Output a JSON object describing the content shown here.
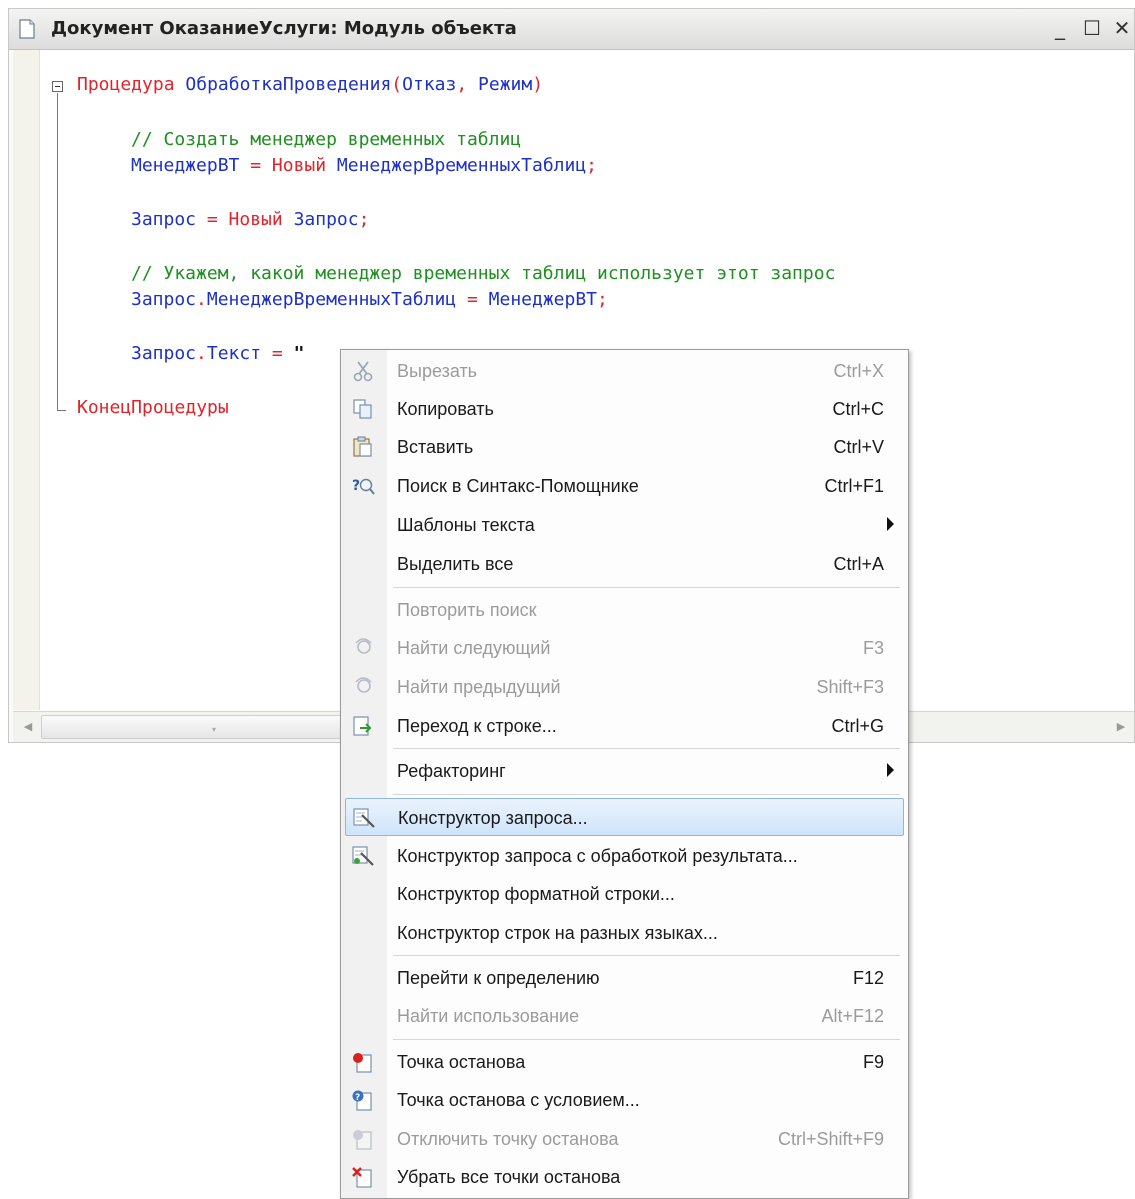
{
  "window": {
    "title": "Документ ОказаниеУслуги: Модуль объекта",
    "min_label": "_",
    "max_label": "☐",
    "close_label": "✕"
  },
  "code": {
    "line1": {
      "kw": "Процедура",
      "name": "ОбработкаПроведения",
      "paren_open": "(",
      "arg1": "Отказ",
      "comma": ", ",
      "arg2": "Режим",
      "paren_close": ")"
    },
    "line2": {
      "comment": "// Создать менеджер временных таблиц"
    },
    "line3": {
      "var": "МенеджерВТ",
      "eq": " = ",
      "new": "Новый",
      "type": " МенеджерВременныхТаблиц",
      "semi": ";"
    },
    "line4": {
      "var": "Запрос",
      "eq": " = ",
      "new": "Новый",
      "type": " Запрос",
      "semi": ";"
    },
    "line5": {
      "comment": "// Укажем, какой менеджер временных таблиц использует этот запрос"
    },
    "line6": {
      "obj": "Запрос",
      "dot": ".",
      "prop": "МенеджерВременныхТаблиц",
      "eq": " = ",
      "val": "МенеджерВТ",
      "semi": ";"
    },
    "line7": {
      "obj": "Запрос",
      "dot": ".",
      "prop": "Текст",
      "eq": " = ",
      "str": "\""
    },
    "line8": {
      "kw": "КонецПроцедуры"
    }
  },
  "context_menu": {
    "items": [
      {
        "label": "Вырезать",
        "shortcut": "Ctrl+X",
        "icon": "scissors-icon",
        "disabled": true
      },
      {
        "label": "Копировать",
        "shortcut": "Ctrl+C",
        "icon": "copy-icon",
        "disabled": false
      },
      {
        "label": "Вставить",
        "shortcut": "Ctrl+V",
        "icon": "paste-icon",
        "disabled": false
      },
      {
        "label": "Поиск в Синтакс-Помощнике",
        "shortcut": "Ctrl+F1",
        "icon": "syntax-help-icon",
        "disabled": false
      },
      {
        "label": "Шаблоны текста",
        "shortcut": "",
        "icon": "",
        "disabled": false,
        "submenu": true
      },
      {
        "label": "Выделить все",
        "shortcut": "Ctrl+A",
        "icon": "",
        "disabled": false
      },
      {
        "label": "Повторить поиск",
        "shortcut": "",
        "icon": "",
        "disabled": true
      },
      {
        "label": "Найти следующий",
        "shortcut": "F3",
        "icon": "find-next-icon",
        "disabled": true
      },
      {
        "label": "Найти предыдущий",
        "shortcut": "Shift+F3",
        "icon": "find-prev-icon",
        "disabled": true
      },
      {
        "label": "Переход к строке...",
        "shortcut": "Ctrl+G",
        "icon": "goto-line-icon",
        "disabled": false
      },
      {
        "label": "Рефакторинг",
        "shortcut": "",
        "icon": "",
        "disabled": false,
        "submenu": true
      },
      {
        "label": "Конструктор запроса...",
        "shortcut": "",
        "icon": "query-builder-icon",
        "disabled": false,
        "selected": true
      },
      {
        "label": "Конструктор запроса с обработкой результата...",
        "shortcut": "",
        "icon": "query-builder-result-icon",
        "disabled": false
      },
      {
        "label": "Конструктор форматной строки...",
        "shortcut": "",
        "icon": "",
        "disabled": false
      },
      {
        "label": "Конструктор строк на разных языках...",
        "shortcut": "",
        "icon": "",
        "disabled": false
      },
      {
        "label": "Перейти к определению",
        "shortcut": "F12",
        "icon": "",
        "disabled": false
      },
      {
        "label": "Найти использование",
        "shortcut": "Alt+F12",
        "icon": "",
        "disabled": true
      },
      {
        "label": "Точка останова",
        "shortcut": "F9",
        "icon": "breakpoint-icon",
        "disabled": false
      },
      {
        "label": "Точка останова с условием...",
        "shortcut": "",
        "icon": "conditional-breakpoint-icon",
        "disabled": false
      },
      {
        "label": "Отключить точку останова",
        "shortcut": "Ctrl+Shift+F9",
        "icon": "disable-breakpoint-icon",
        "disabled": true
      },
      {
        "label": "Убрать все точки останова",
        "shortcut": "",
        "icon": "remove-breakpoints-icon",
        "disabled": false
      }
    ]
  },
  "colors": {
    "keyword": "#e0242c",
    "identifier": "#1d30c8",
    "comment": "#1f8f1f",
    "selection": "#cfe4fa",
    "disabled_text": "#9b9b9b"
  }
}
